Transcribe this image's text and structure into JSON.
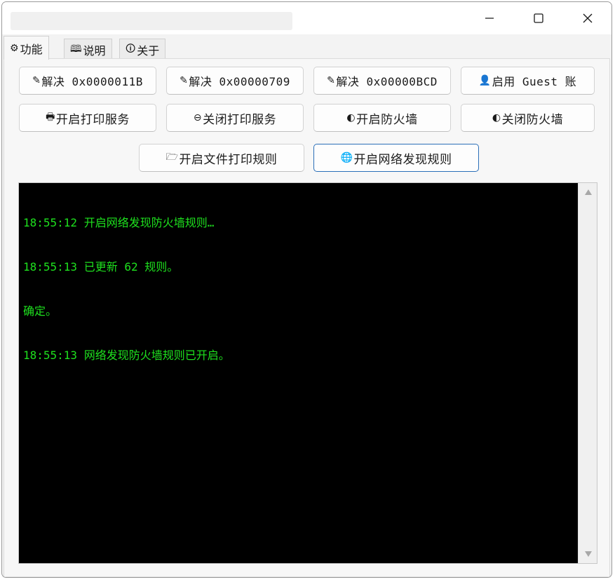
{
  "window": {
    "controls": {
      "minimize": "minimize-icon",
      "maximize": "maximize-icon",
      "close": "close-icon"
    }
  },
  "tabs": [
    {
      "icon": "⚙",
      "label": "功能",
      "active": true
    },
    {
      "icon": "🕮",
      "label": "说明",
      "active": false
    },
    {
      "icon": "🛈",
      "label": "关于",
      "active": false
    }
  ],
  "buttons": {
    "row1": [
      {
        "icon": "✎",
        "label": "解决 0x0000011B"
      },
      {
        "icon": "✎",
        "label": "解决 0x00000709"
      },
      {
        "icon": "✎",
        "label": "解决 0x00000BCD"
      },
      {
        "icon": "👤",
        "label": "启用 Guest 账"
      }
    ],
    "row2": [
      {
        "icon": "🖶",
        "label": "开启打印服务"
      },
      {
        "icon": "⊖",
        "label": "关闭打印服务"
      },
      {
        "icon": "◐",
        "label": "开启防火墙"
      },
      {
        "icon": "◐",
        "label": "关闭防火墙"
      }
    ],
    "row3": [
      {
        "icon": "🗁",
        "label": "开启文件打印规则"
      },
      {
        "icon": "🌐",
        "label": "开启网络发现规则"
      }
    ]
  },
  "console": {
    "lines": [
      "18:55:12 开启网络发现防火墙规则…",
      "18:55:13 已更新 62 规则。",
      "确定。",
      "18:55:13 网络发现防火墙规则已开启。"
    ],
    "text_color": "#1ee01e",
    "background": "#000000"
  }
}
